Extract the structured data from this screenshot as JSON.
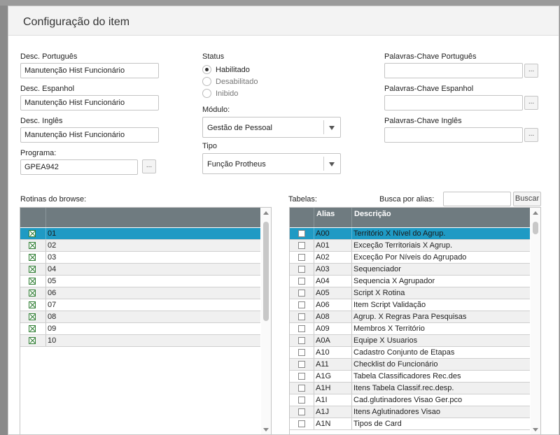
{
  "dialog": {
    "title": "Configuração do item"
  },
  "fields": {
    "desc_pt": {
      "label": "Desc. Português",
      "value": "Manutenção Hist Funcionário"
    },
    "desc_es": {
      "label": "Desc. Espanhol",
      "value": "Manutenção Hist Funcionário"
    },
    "desc_en": {
      "label": "Desc. Inglês",
      "value": "Manutenção Hist Funcionário"
    },
    "programa": {
      "label": "Programa:",
      "value": "GPEA942",
      "button": "..."
    }
  },
  "status": {
    "label": "Status",
    "options": [
      {
        "label": "Habilitado",
        "selected": true
      },
      {
        "label": "Desabilitado",
        "selected": false
      },
      {
        "label": "Inibido",
        "selected": false
      }
    ]
  },
  "modulo": {
    "label": "Módulo:",
    "value": "Gestão de Pessoal"
  },
  "tipo": {
    "label": "Tipo",
    "value": "Função Protheus"
  },
  "keywords": {
    "pt": {
      "label": "Palavras-Chave Português",
      "value": "",
      "button": "..."
    },
    "es": {
      "label": "Palavras-Chave Espanhol",
      "value": "",
      "button": "..."
    },
    "en": {
      "label": "Palavras-Chave Inglês",
      "value": "",
      "button": "..."
    }
  },
  "rotinas": {
    "label": "Rotinas do browse:",
    "selected_index": 0,
    "rows": [
      {
        "checked": true,
        "value": "01"
      },
      {
        "checked": true,
        "value": "02"
      },
      {
        "checked": true,
        "value": "03"
      },
      {
        "checked": true,
        "value": "04"
      },
      {
        "checked": true,
        "value": "05"
      },
      {
        "checked": true,
        "value": "06"
      },
      {
        "checked": true,
        "value": "07"
      },
      {
        "checked": true,
        "value": "08"
      },
      {
        "checked": true,
        "value": "09"
      },
      {
        "checked": true,
        "value": "10"
      }
    ]
  },
  "tabelas": {
    "label": "Tabelas:",
    "search_label": "Busca por alias:",
    "search_value": "",
    "search_button": "Buscar",
    "columns": {
      "alias": "Alias",
      "descricao": "Descrição"
    },
    "selected_index": 0,
    "rows": [
      {
        "checked": false,
        "alias": "A00",
        "descricao": "Território X Nível do Agrup."
      },
      {
        "checked": false,
        "alias": "A01",
        "descricao": "Exceção Territoriais X Agrup."
      },
      {
        "checked": false,
        "alias": "A02",
        "descricao": "Exceção Por Níveis do Agrupado"
      },
      {
        "checked": false,
        "alias": "A03",
        "descricao": "Sequenciador"
      },
      {
        "checked": false,
        "alias": "A04",
        "descricao": "Sequencia X Agrupador"
      },
      {
        "checked": false,
        "alias": "A05",
        "descricao": "Script X Rotina"
      },
      {
        "checked": false,
        "alias": "A06",
        "descricao": "Item Script Validação"
      },
      {
        "checked": false,
        "alias": "A08",
        "descricao": "Agrup. X Regras Para Pesquisas"
      },
      {
        "checked": false,
        "alias": "A09",
        "descricao": "Membros X Território"
      },
      {
        "checked": false,
        "alias": "A0A",
        "descricao": "Equipe X Usuarios"
      },
      {
        "checked": false,
        "alias": "A10",
        "descricao": "Cadastro Conjunto de Etapas"
      },
      {
        "checked": false,
        "alias": "A11",
        "descricao": "Checklist do Funcionário"
      },
      {
        "checked": false,
        "alias": "A1G",
        "descricao": "Tabela Classificadores Rec.des"
      },
      {
        "checked": false,
        "alias": "A1H",
        "descricao": "Itens Tabela Classif.rec.desp."
      },
      {
        "checked": false,
        "alias": "A1I",
        "descricao": "Cad.glutinadores Visao Ger.pco"
      },
      {
        "checked": false,
        "alias": "A1J",
        "descricao": "Itens Aglutinadores Visao"
      },
      {
        "checked": false,
        "alias": "A1N",
        "descricao": "Tipos de Card"
      }
    ]
  },
  "colors": {
    "header": "#6f7b80",
    "selection": "#1f9ac4",
    "checkmark": "#2e7d32"
  }
}
